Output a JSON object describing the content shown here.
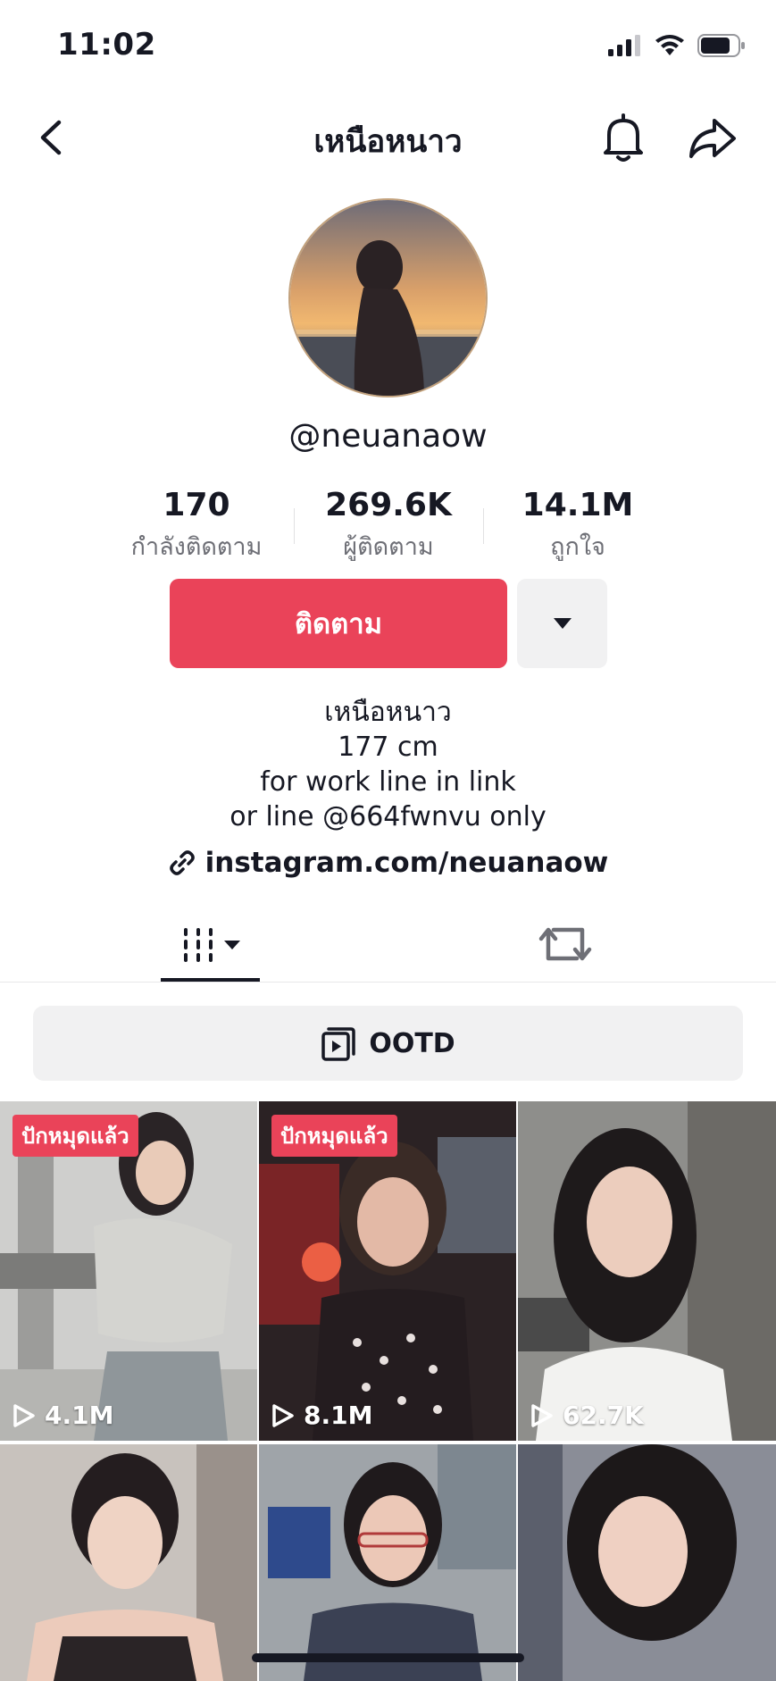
{
  "status_bar": {
    "time": "11:02"
  },
  "nav": {
    "title": "เหนือหนาว"
  },
  "profile": {
    "username": "@neuanaow",
    "stats": [
      {
        "value": "170",
        "label": "กำลังติดตาม"
      },
      {
        "value": "269.6K",
        "label": "ผู้ติดตาม"
      },
      {
        "value": "14.1M",
        "label": "ถูกใจ"
      }
    ],
    "follow_label": "ติดตาม",
    "bio": [
      "เหนือหนาว",
      "177 cm",
      "for work line in link",
      "or line @664fwnvu only"
    ],
    "link": "instagram.com/neuanaow"
  },
  "playlist": {
    "label": "OOTD"
  },
  "videos": [
    {
      "pinned_label": "ปักหมุดแล้ว",
      "views": "4.1M"
    },
    {
      "pinned_label": "ปักหมุดแล้ว",
      "views": "8.1M"
    },
    {
      "pinned_label": "",
      "views": "62.7K"
    },
    {
      "pinned_label": "",
      "views": ""
    },
    {
      "pinned_label": "",
      "views": ""
    },
    {
      "pinned_label": "",
      "views": ""
    }
  ],
  "colors": {
    "accent": "#ea4359",
    "text": "#161823",
    "secondary": "#6e6f76",
    "surface": "#f1f1f2"
  }
}
